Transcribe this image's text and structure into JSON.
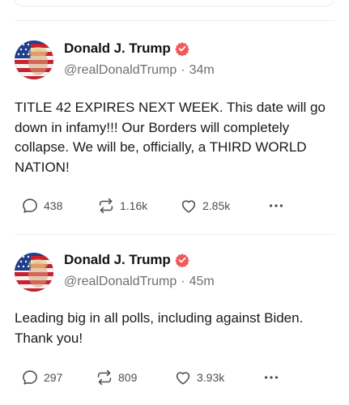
{
  "posts": [
    {
      "author_name": "Donald J. Trump",
      "handle": "@realDonaldTrump",
      "separator": "·",
      "time": "34m",
      "text": "TITLE 42 EXPIRES NEXT WEEK. This date will go down in infamy!!! Our Borders will completely collapse. We will be, officially, a THIRD WORLD NATION!",
      "replies": "438",
      "reposts": "1.16k",
      "likes": "2.85k"
    },
    {
      "author_name": "Donald J. Trump",
      "handle": "@realDonaldTrump",
      "separator": "·",
      "time": "45m",
      "text": "Leading big in all polls, including against Biden. Thank you!",
      "replies": "297",
      "reposts": "809",
      "likes": "3.93k"
    }
  ],
  "icons": {
    "verified": "verified-badge-icon",
    "reply": "speech-bubble-icon",
    "repost": "repost-arrows-icon",
    "like": "heart-icon",
    "more": "more-dots-icon"
  },
  "colors": {
    "verified_badge": "#f05a5a",
    "muted_text": "#6b7075",
    "divider": "#eceef0"
  }
}
